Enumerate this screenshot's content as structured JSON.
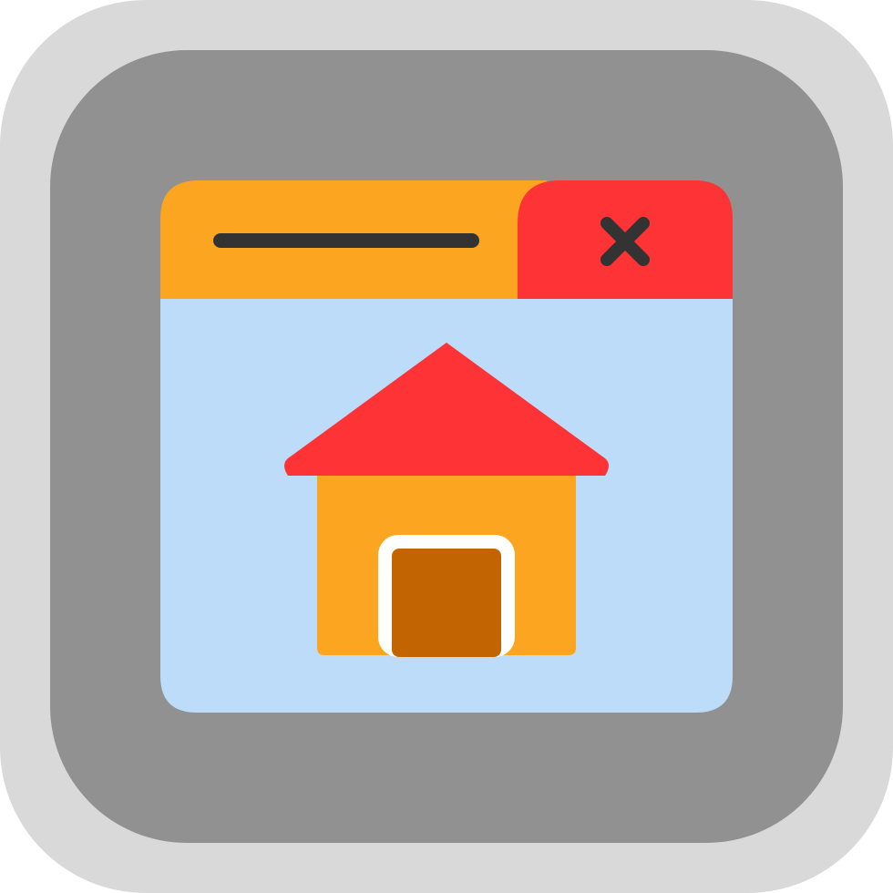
{
  "icon": {
    "subject": "browser-window-home-icon",
    "colors": {
      "outer_frame": "#d9d9d9",
      "inner_frame": "#919191",
      "title_bar": "#fca521",
      "close_tab": "#fe3335",
      "close_glyph": "#333333",
      "title_line": "#333333",
      "window_body": "#bcdcf9",
      "roof": "#fe3335",
      "house_wall": "#fca521",
      "door_outline": "#ffffff",
      "door": "#c26401"
    },
    "parts": {
      "close_icon": "close-icon",
      "title_placeholder": "title-line",
      "house_icon": "house-icon"
    }
  }
}
